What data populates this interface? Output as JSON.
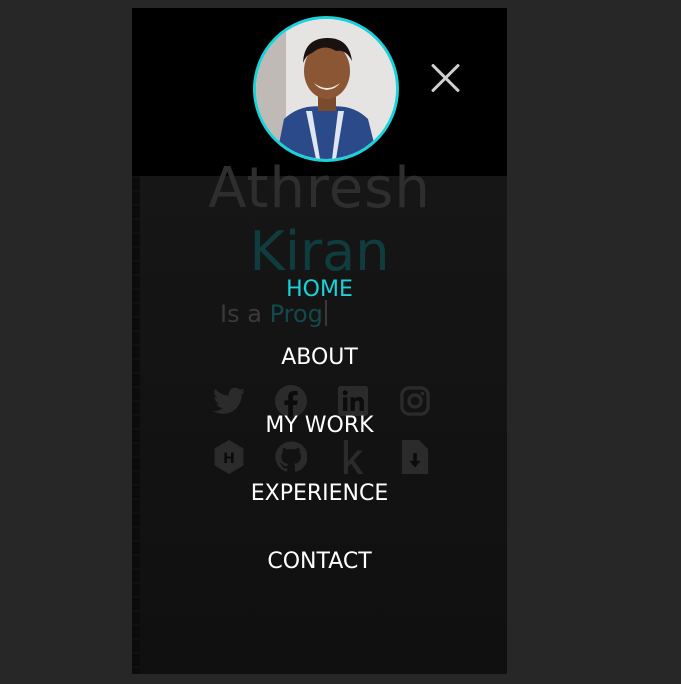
{
  "hero": {
    "first_name": "Athresh",
    "last_name": "Kiran",
    "tagline_prefix": "Is a",
    "tagline_typed": "Prog"
  },
  "menu": {
    "items": [
      {
        "label": "HOME",
        "active": true
      },
      {
        "label": "ABOUT",
        "active": false
      },
      {
        "label": "MY WORK",
        "active": false
      },
      {
        "label": "EXPERIENCE",
        "active": false
      },
      {
        "label": "CONTACT",
        "active": false
      }
    ]
  },
  "social": {
    "icons": [
      "twitter-icon",
      "facebook-icon",
      "linkedin-icon",
      "instagram-icon",
      "hackerrank-icon",
      "github-icon",
      "kaggle-icon",
      "resume-download-icon"
    ]
  },
  "colors": {
    "accent": "#19d3da",
    "menu_text": "#ffffff",
    "page_bg": "#272727",
    "overlay_bg": "#0c0c0c"
  }
}
